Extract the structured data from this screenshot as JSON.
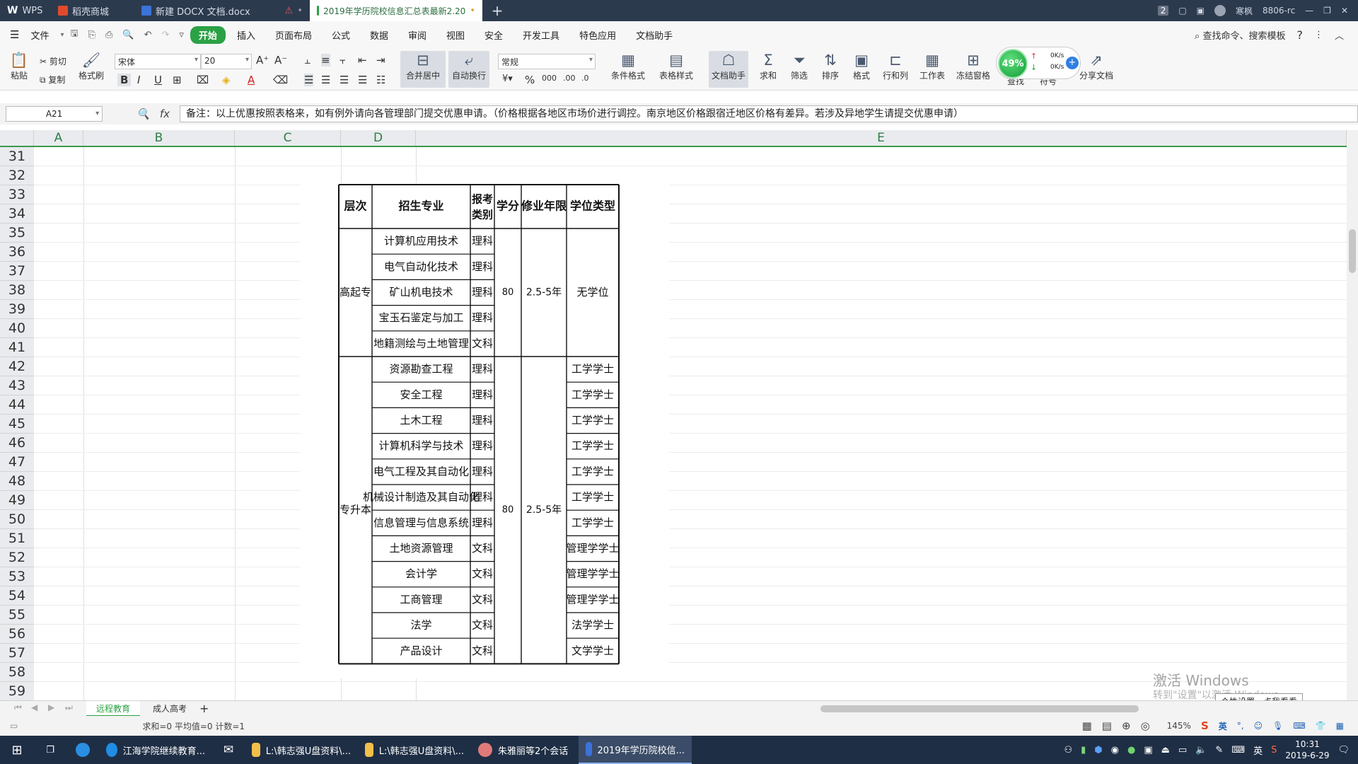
{
  "titlebar": {
    "tabs": [
      {
        "label": "WPS",
        "active": false
      },
      {
        "label": "稻壳商城",
        "active": false
      },
      {
        "label": "新建 DOCX 文档.docx",
        "active": false
      },
      {
        "label": "2019年学历院校信息汇总表最新2.20",
        "active": true
      }
    ],
    "new_tab": "+",
    "badge": "2",
    "user": "寒枫",
    "right_text": "8806-rc"
  },
  "menubar": {
    "file": "文件",
    "items": [
      "开始",
      "插入",
      "页面布局",
      "公式",
      "数据",
      "审阅",
      "视图",
      "安全",
      "开发工具",
      "特色应用",
      "文档助手"
    ],
    "active": "开始",
    "search": "查找命令、搜索模板",
    "help": "?"
  },
  "ribbon": {
    "paste": "粘贴",
    "cut": "剪切",
    "copy": "复制",
    "format_painter": "格式刷",
    "font_name": "宋体",
    "font_size": "20",
    "merge": "合并居中",
    "wrap": "自动换行",
    "number_format": "常规",
    "cond_format": "条件格式",
    "table_style": "表格样式",
    "doc_helper": "文档助手",
    "sum": "求和",
    "filter": "筛选",
    "sort": "排序",
    "format": "格式",
    "rowcol": "行和列",
    "worksheet": "工作表",
    "freeze": "冻结窗格",
    "find": "查找",
    "symbol": "符号",
    "share": "分享文档"
  },
  "netwidget": {
    "cpu": "49%",
    "up": "0K/s",
    "down": "0K/s"
  },
  "formulabar": {
    "cell": "A21",
    "fx": "fx",
    "content": "备注：以上优惠按照表格来，如有例外请向各管理部门提交优惠申请。（价格根据各地区市场价进行调控。南京地区价格跟宿迁地区价格有差异。若涉及异地学生请提交优惠申请）"
  },
  "columns": [
    "A",
    "B",
    "C",
    "D",
    "E"
  ],
  "rows": [
    "31",
    "32",
    "33",
    "34",
    "35",
    "36",
    "37",
    "38",
    "39",
    "40",
    "41",
    "42",
    "43",
    "44",
    "45",
    "46",
    "47",
    "48",
    "49",
    "50",
    "51",
    "52",
    "53",
    "54",
    "55",
    "56",
    "57",
    "58",
    "59"
  ],
  "table": {
    "headers": [
      "层次",
      "招生专业",
      "报考\n类别",
      "学分",
      "修业年限",
      "学位类型"
    ],
    "groups": [
      {
        "level": "高起专",
        "credits": "80",
        "years": "2.5-5年",
        "rows": [
          {
            "major": "计算机应用技术",
            "cat": "理科",
            "degree": "无学位"
          },
          {
            "major": "电气自动化技术",
            "cat": "理科",
            "degree": ""
          },
          {
            "major": "矿山机电技术",
            "cat": "理科",
            "degree": ""
          },
          {
            "major": "宝玉石鉴定与加工",
            "cat": "理科",
            "degree": ""
          },
          {
            "major": "地籍测绘与土地管理",
            "cat": "文科",
            "degree": ""
          }
        ]
      },
      {
        "level": "专升本",
        "credits": "80",
        "years": "2.5-5年",
        "rows": [
          {
            "major": "资源勘查工程",
            "cat": "理科",
            "degree": "工学学士"
          },
          {
            "major": "安全工程",
            "cat": "理科",
            "degree": "工学学士"
          },
          {
            "major": "土木工程",
            "cat": "理科",
            "degree": "工学学士"
          },
          {
            "major": "计算机科学与技术",
            "cat": "理科",
            "degree": "工学学士"
          },
          {
            "major": "电气工程及其自动化",
            "cat": "理科",
            "degree": "工学学士"
          },
          {
            "major": "机械设计制造及其自动化",
            "cat": "理科",
            "degree": "工学学士"
          },
          {
            "major": "信息管理与信息系统",
            "cat": "理科",
            "degree": "工学学士"
          },
          {
            "major": "土地资源管理",
            "cat": "文科",
            "degree": "管理学学士"
          },
          {
            "major": "会计学",
            "cat": "文科",
            "degree": "管理学学士"
          },
          {
            "major": "工商管理",
            "cat": "文科",
            "degree": "管理学学士"
          },
          {
            "major": "法学",
            "cat": "文科",
            "degree": "法学学士"
          },
          {
            "major": "产品设计",
            "cat": "文科",
            "degree": "文学学士"
          }
        ]
      }
    ]
  },
  "watermark": {
    "line1": "激活 Windows",
    "line2": "转到\"设置\"以激活 Windows。"
  },
  "tooltip": "个性设置，点我看看",
  "sheet_tabs": [
    "远程教育",
    "成人高考"
  ],
  "active_sheet": "远程教育",
  "add_sheet": "+",
  "status": {
    "summary": "求和=0  平均值=0  计数=1",
    "zoom": "145%"
  },
  "ime": {
    "lang": "英"
  },
  "taskbar": {
    "items": [
      {
        "label": "江海学院继续教育...",
        "active": false
      },
      {
        "label": "",
        "active": false
      },
      {
        "label": "L:\\韩志强U盘资料\\...",
        "active": false
      },
      {
        "label": "L:\\韩志强U盘资料\\...",
        "active": false
      },
      {
        "label": "朱雅丽等2个会话",
        "active": false
      },
      {
        "label": "2019年学历院校信...",
        "active": true
      }
    ],
    "lang": "英",
    "time": "10:31",
    "date": "2019-6-29"
  }
}
